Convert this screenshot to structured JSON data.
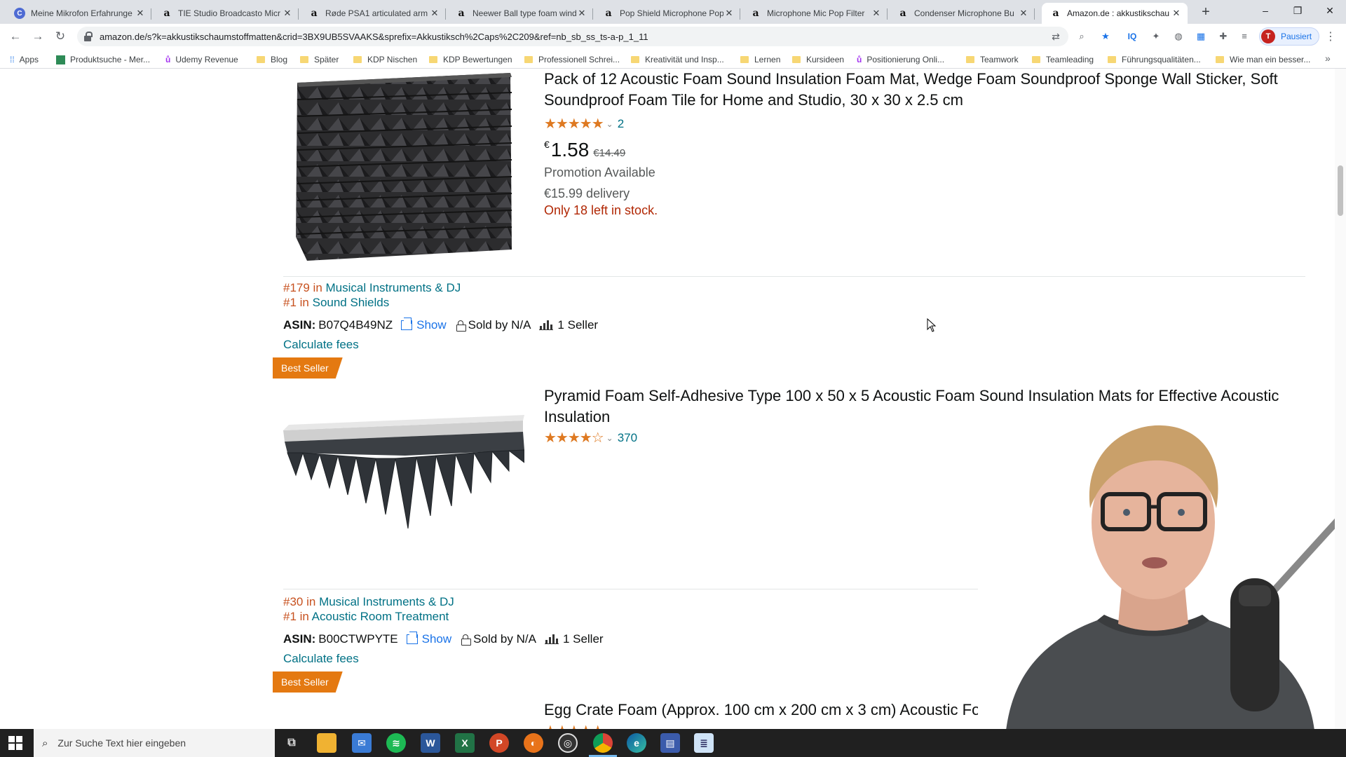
{
  "browser": {
    "tabs": [
      {
        "title": "Meine Mikrofon Erfahrunge",
        "favicon": "c"
      },
      {
        "title": "TIE Studio Broadcasto Micr",
        "favicon": "a"
      },
      {
        "title": "Røde PSA1 articulated arm",
        "favicon": "a"
      },
      {
        "title": "Neewer Ball type foam wind",
        "favicon": "a"
      },
      {
        "title": "Pop Shield Microphone Pop",
        "favicon": "a"
      },
      {
        "title": "Microphone Mic Pop Filter",
        "favicon": "a"
      },
      {
        "title": "Condenser Microphone Bu",
        "favicon": "a"
      },
      {
        "title": "Amazon.de : akkustikschau",
        "favicon": "a"
      }
    ],
    "new_tab": "+",
    "window_controls": {
      "minimize": "–",
      "maximize": "❐",
      "close": "✕"
    },
    "url": "amazon.de/s?k=akkustikschaumstoffmatten&crid=3BX9UB5SVAAKS&sprefix=Akkustiksch%2Caps%2C209&ref=nb_sb_ss_ts-a-p_1_11",
    "profile_initial": "T",
    "profile_label": "Pausiert",
    "bookmarks": [
      {
        "label": "Apps",
        "icon": "apps-grid"
      },
      {
        "label": "Produktsuche - Mer...",
        "icon": "green-square"
      },
      {
        "label": "Udemy Revenue",
        "icon": "udemy"
      },
      {
        "label": "Blog",
        "icon": "folder"
      },
      {
        "label": "Später",
        "icon": "folder"
      },
      {
        "label": "KDP Nischen",
        "icon": "folder"
      },
      {
        "label": "KDP Bewertungen",
        "icon": "folder"
      },
      {
        "label": "Professionell Schrei...",
        "icon": "folder"
      },
      {
        "label": "Kreativität und Insp...",
        "icon": "folder"
      },
      {
        "label": "Lernen",
        "icon": "folder"
      },
      {
        "label": "Kursideen",
        "icon": "folder"
      },
      {
        "label": "Positionierung Onli...",
        "icon": "udemy"
      },
      {
        "label": "Teamwork",
        "icon": "folder"
      },
      {
        "label": "Teamleading",
        "icon": "folder"
      },
      {
        "label": "Führungsqualitäten...",
        "icon": "folder"
      },
      {
        "label": "Wie man ein besser...",
        "icon": "folder"
      }
    ],
    "bookmarks_more": "»"
  },
  "products": [
    {
      "title": "Pack of 12 Acoustic Foam Sound Insulation Foam Mat, Wedge Foam Soundproof Sponge Wall Sticker, Soft Soundproof Foam Tile for Home and Studio, 30 x 30 x 2.5 cm",
      "rating_stars": 5,
      "review_count": "2",
      "currency": "€",
      "price": "1.58",
      "old_price": "€14.49",
      "promotion": "Promotion Available",
      "delivery": "€15.99 delivery",
      "stock": "Only 18 left in stock.",
      "ranks": [
        {
          "num": "#179 in",
          "cat": "Musical Instruments & DJ"
        },
        {
          "num": "#1 in",
          "cat": "Sound Shields"
        }
      ],
      "asin_label": "ASIN:",
      "asin": "B07Q4B49NZ",
      "show": "Show",
      "sold_by": "Sold by N/A",
      "sellers": "1 Seller",
      "calc": "Calculate fees",
      "badge": "Best Seller"
    },
    {
      "title": "Pyramid Foam Self-Adhesive Type 100 x 50 x 5 Acoustic Foam Sound Insulation Mats for Effective Acoustic Insulation",
      "rating_stars": 4.5,
      "review_count": "370",
      "ranks": [
        {
          "num": "#30 in",
          "cat": "Musical Instruments & DJ"
        },
        {
          "num": "#1 in",
          "cat": "Acoustic Room Treatment"
        }
      ],
      "asin_label": "ASIN:",
      "asin": "B00CTWPYTE",
      "show": "Show",
      "sold_by": "Sold by N/A",
      "sellers": "1 Seller",
      "calc": "Calculate fees",
      "badge": "Best Seller"
    },
    {
      "title": "Egg Crate Foam (Approx. 100 cm x 200 cm x 3 cm) Acoustic Fo"
    }
  ],
  "taskbar": {
    "search_placeholder": "Zur Suche Text hier eingeben",
    "apps": [
      "task-view",
      "file-explorer",
      "mail",
      "spotify",
      "word",
      "excel",
      "powerpoint",
      "app-orange",
      "obs",
      "chrome",
      "edge",
      "app-blue",
      "notepad"
    ]
  },
  "colors": {
    "link": "#007185",
    "rank_num": "#c7511f",
    "star": "#de7921",
    "stock": "#b12704",
    "badge": "#e47911"
  }
}
